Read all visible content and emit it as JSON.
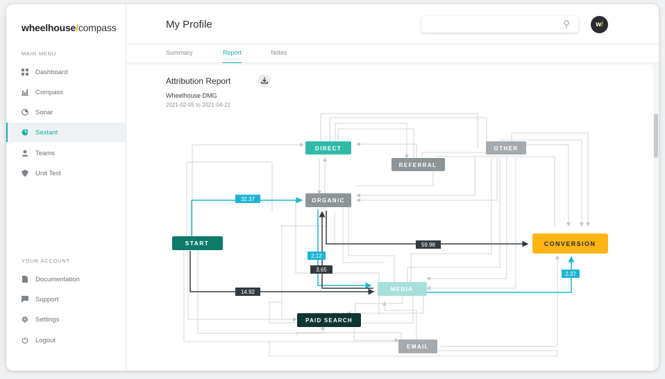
{
  "app": {
    "logo_bold": "wheelhouse",
    "logo_slash": "/",
    "logo_rest": "compass"
  },
  "sidebar": {
    "main_menu_label": "MAIN MENU",
    "items": [
      {
        "label": "Dashboard",
        "icon": "dashboard-icon"
      },
      {
        "label": "Compass",
        "icon": "bar-chart-icon"
      },
      {
        "label": "Sonar",
        "icon": "sonar-icon"
      },
      {
        "label": "Sextant",
        "icon": "pie-chart-icon"
      },
      {
        "label": "Teams",
        "icon": "user-icon"
      },
      {
        "label": "Unit Test",
        "icon": "shield-icon"
      }
    ],
    "account_label": "YOUR ACCOUNT",
    "account_items": [
      {
        "label": "Documentation",
        "icon": "document-icon"
      },
      {
        "label": "Support",
        "icon": "chat-icon"
      },
      {
        "label": "Settings",
        "icon": "gear-icon"
      },
      {
        "label": "Logout",
        "icon": "power-icon"
      }
    ]
  },
  "header": {
    "title": "My Profile",
    "search_value": "",
    "avatar_text": "w",
    "avatar_slash": "/"
  },
  "tabs": [
    {
      "label": "Summary"
    },
    {
      "label": "Report"
    },
    {
      "label": "Notes"
    }
  ],
  "report": {
    "title": "Attribution Report",
    "organization": "Wheelhouse DMG",
    "date_range": "2021-02-05 to 2021-04-22"
  },
  "diagram": {
    "nodes": {
      "start": "START",
      "direct": "DIRECT",
      "referral": "REFERRAL",
      "other": "OTHER",
      "organic": "ORGANIC",
      "conversion": "CONVERSION",
      "media": "MEDIA",
      "paid_search": "PAID SEARCH",
      "email": "EMAIL"
    },
    "flows": {
      "start_organic": "32.37",
      "organic_conversion": "59.98",
      "organic_media": "2.12",
      "media_organic": "3.65",
      "start_media": "14.92",
      "media_conversion": "2.37"
    }
  },
  "colors": {
    "accent": "#1ab1a6",
    "flow_cyan": "#1cb5d3",
    "flow_dark": "#333a3f",
    "conversion": "#fdb515",
    "start": "#0e7a6a",
    "direct": "#2fbba8",
    "media": "#a7dfdb",
    "paid_search": "#0e3733",
    "grey_node": "#8e9599"
  }
}
